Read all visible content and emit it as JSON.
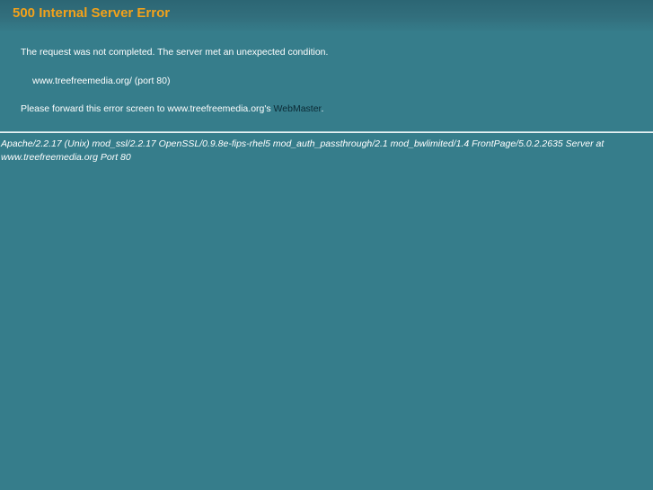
{
  "header": {
    "title": "500 Internal Server Error"
  },
  "message": {
    "line1": "The request was not completed. The server met an unexpected condition.",
    "line2": "www.treefreemedia.org/ (port 80)",
    "line3_prefix": "Please forward this error screen to www.treefreemedia.org's ",
    "line3_link": "WebMaster",
    "line3_suffix": "."
  },
  "signature": {
    "text": "Apache/2.2.17 (Unix) mod_ssl/2.2.17 OpenSSL/0.9.8e-fips-rhel5 mod_auth_passthrough/2.1 mod_bwlimited/1.4 FrontPage/5.0.2.2635 Server at www.treefreemedia.org Port 80"
  },
  "colors": {
    "background": "#367d8b",
    "title": "#f3a21a",
    "link": "#0b2a35"
  }
}
